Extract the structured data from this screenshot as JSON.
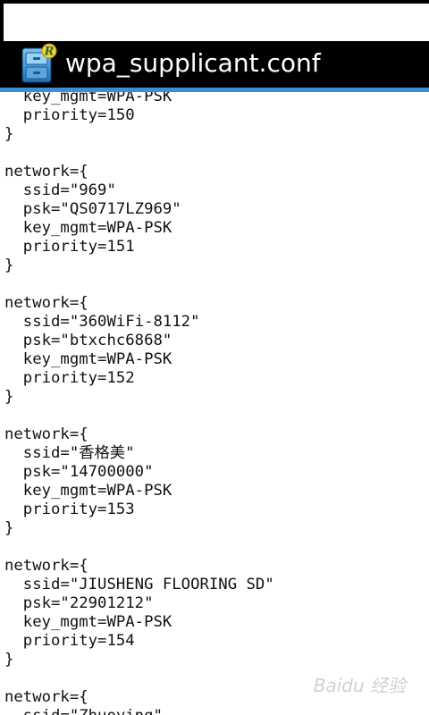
{
  "app": {
    "title": "wpa_supplicant.conf",
    "icon": "root-explorer-file-cabinet-icon",
    "accent_color": "#3a8fd8"
  },
  "file_lines": [
    "  key_mgmt=WPA-PSK",
    "  priority=150",
    "}",
    "",
    "network={",
    "  ssid=\"969\"",
    "  psk=\"QS0717LZ969\"",
    "  key_mgmt=WPA-PSK",
    "  priority=151",
    "}",
    "",
    "network={",
    "  ssid=\"360WiFi-8112\"",
    "  psk=\"btxchc6868\"",
    "  key_mgmt=WPA-PSK",
    "  priority=152",
    "}",
    "",
    "network={",
    "  ssid=\"香格美\"",
    "  psk=\"14700000\"",
    "  key_mgmt=WPA-PSK",
    "  priority=153",
    "}",
    "",
    "network={",
    "  ssid=\"JIUSHENG FLOORING SD\"",
    "  psk=\"22901212\"",
    "  key_mgmt=WPA-PSK",
    "  priority=154",
    "}",
    "",
    "network={",
    "  ssid=\"Zhuoying\""
  ],
  "watermark": "Baidu 经验"
}
